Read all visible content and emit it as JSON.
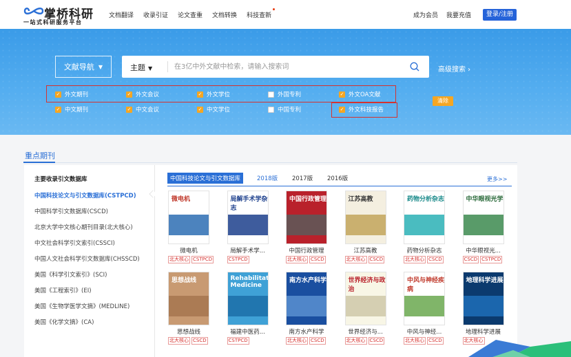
{
  "header": {
    "logo_text": "掌桥科研",
    "logo_sub": "一站式科研服务平台",
    "nav": [
      "文档翻译",
      "收录引证",
      "论文查重",
      "文档转换",
      "科技查新"
    ],
    "member": "成为会员",
    "recharge": "我要充值",
    "login": "登录/注册"
  },
  "banner": {
    "lit_nav": "文献导航",
    "search_type": "主题",
    "search_placeholder": "在3亿中外文献中检索，请输入搜索词",
    "adv_search": "高级搜索 ›",
    "clear": "清除",
    "filters_row1": [
      {
        "label": "外文期刊",
        "checked": true
      },
      {
        "label": "外文会议",
        "checked": true
      },
      {
        "label": "外文学位",
        "checked": true
      },
      {
        "label": "外国专利",
        "checked": false
      },
      {
        "label": "外文OA文献",
        "checked": true
      }
    ],
    "filters_row2": [
      {
        "label": "中文期刊",
        "checked": true
      },
      {
        "label": "中文会议",
        "checked": true
      },
      {
        "label": "中文学位",
        "checked": true
      },
      {
        "label": "中国专利",
        "checked": false
      },
      {
        "label": "外文科技报告",
        "checked": true
      }
    ]
  },
  "section": {
    "title": "重点期刊",
    "side_head": "主要收录引文数据库",
    "side_items": [
      "中国科技论文与引文数据库(CSTPCD)",
      "中国科学引文数据库(CSCD)",
      "北京大学中文核心期刊目录(北大核心)",
      "中文社会科学引文索引(CSSCI)",
      "中国人文社会科学引文数据库(CHSSCD)",
      "美国《科学引文索引》(SCI)",
      "美国《工程索引》(EI)",
      "美国《生物学医学文摘》(MEDLINE)",
      "美国《化学文摘》(CA)"
    ],
    "tabs": [
      "中国科技论文与引文数据库",
      "2018版",
      "2017版",
      "2016版"
    ],
    "more": "更多>>",
    "journals_row1": [
      {
        "name": "微电机",
        "tags": [
          "北大核心",
          "CSTPCD"
        ],
        "cover_title": "微电机",
        "bg": "#ffffff",
        "fg": "#c0392b",
        "accent": "#2d6db3"
      },
      {
        "name": "局解手术学...",
        "tags": [
          "CSTPCD"
        ],
        "cover_title": "局解手术学杂志",
        "bg": "#ffffff",
        "fg": "#1c3f8c",
        "accent": "#1c3f8c"
      },
      {
        "name": "中国行政管理",
        "tags": [
          "北大核心",
          "CSCD"
        ],
        "cover_title": "中国行政管理",
        "bg": "#b9212b",
        "fg": "#ffffff",
        "accent": "#5a5a5a"
      },
      {
        "name": "江苏高教",
        "tags": [
          "北大核心",
          "CSCD"
        ],
        "cover_title": "江苏高教",
        "bg": "#f4efe0",
        "fg": "#333333",
        "accent": "#c2a55a"
      },
      {
        "name": "药物分析杂志",
        "tags": [
          "北大核心",
          "CSCD"
        ],
        "cover_title": "药物分析杂志",
        "bg": "#ffffff",
        "fg": "#1a8a8a",
        "accent": "#2ab0b5"
      },
      {
        "name": "中华眼视光...",
        "tags": [
          "CSCD",
          "CSTPCD"
        ],
        "cover_title": "中华眼视光学",
        "bg": "#ffffff",
        "fg": "#2a6a3a",
        "accent": "#3c8a4f"
      }
    ],
    "journals_row2": [
      {
        "name": "思想战线",
        "tags": [
          "北大核心",
          "CSCD"
        ],
        "cover_title": "思想战线",
        "bg": "#c89a72",
        "fg": "#ffffff",
        "accent": "#a6764f"
      },
      {
        "name": "福建中医药...",
        "tags": [
          "CSTPCD"
        ],
        "cover_title": "Rehabilitation Medicine",
        "bg": "#3fa1d6",
        "fg": "#ffffff",
        "accent": "#1c6fa8"
      },
      {
        "name": "南方水产科学",
        "tags": [
          "北大核心",
          "CSCD"
        ],
        "cover_title": "南方水产科学",
        "bg": "#1a4fa0",
        "fg": "#ffffff",
        "accent": "#5a8fd0"
      },
      {
        "name": "世界经济与...",
        "tags": [
          "北大核心",
          "CSCD"
        ],
        "cover_title": "世界经济与政治",
        "bg": "#f8f6e6",
        "fg": "#b9212b",
        "accent": "#cfc8a8"
      },
      {
        "name": "中风与神经...",
        "tags": [
          "北大核心",
          "CSCD"
        ],
        "cover_title": "中风与神经疾病",
        "bg": "#ffffff",
        "fg": "#c0392b",
        "accent": "#6aa84f"
      },
      {
        "name": "地理科学进展",
        "tags": [
          "北大核心"
        ],
        "cover_title": "地理科学进展",
        "bg": "#0b3a6e",
        "fg": "#ffffff",
        "accent": "#1f6fb8"
      }
    ]
  }
}
